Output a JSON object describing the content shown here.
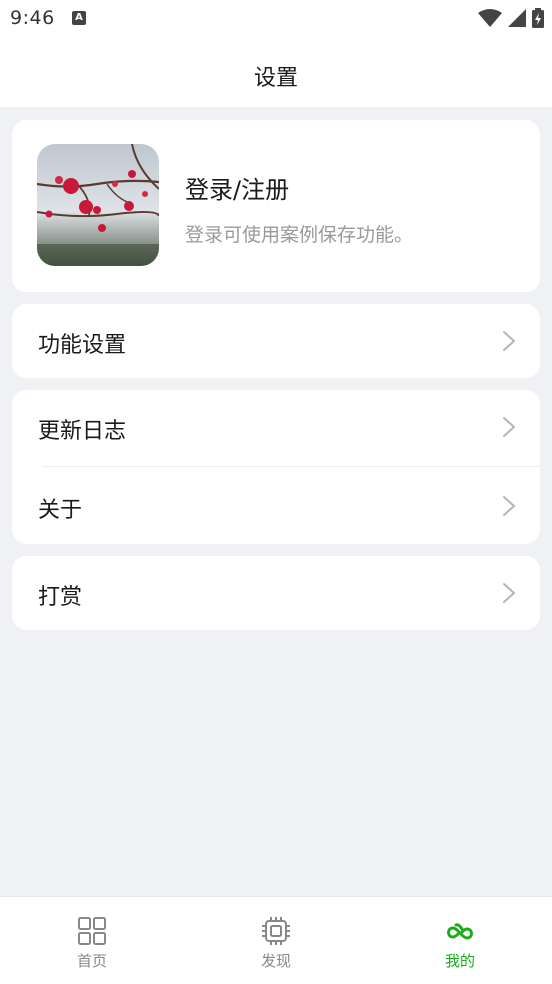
{
  "status": {
    "time": "9:46",
    "notification_icon": "a-notification-icon"
  },
  "header": {
    "title": "设置"
  },
  "profile": {
    "title": "登录/注册",
    "subtitle": "登录可使用案例保存功能。",
    "avatar": "plum-blossom-avatar"
  },
  "menu": {
    "feature_settings": "功能设置",
    "changelog": "更新日志",
    "about": "关于",
    "donate": "打赏"
  },
  "tabs": [
    {
      "label": "首页",
      "icon": "grid-icon",
      "active": false
    },
    {
      "label": "发现",
      "icon": "chip-icon",
      "active": false
    },
    {
      "label": "我的",
      "icon": "cloud-icon",
      "active": true
    }
  ],
  "colors": {
    "accent": "#1aad19",
    "background": "#f0f1f4",
    "card": "#ffffff",
    "text_secondary": "#9a9a9a"
  }
}
